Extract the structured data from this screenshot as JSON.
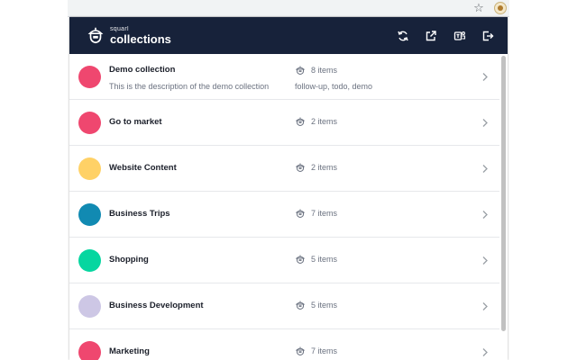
{
  "browser": {
    "star_icon": "star-icon",
    "extension_icon": "acorn-extension-icon"
  },
  "header": {
    "logo_small": "squarl",
    "logo_big": "collections",
    "buttons": [
      {
        "name": "sync-icon"
      },
      {
        "name": "open-external-icon"
      },
      {
        "name": "teams-icon"
      },
      {
        "name": "logout-icon"
      }
    ],
    "background": "#17223a"
  },
  "collections": [
    {
      "name": "Demo collection",
      "description": "This is the description of the demo collection",
      "count": "8 items",
      "tags": "follow-up, todo, demo",
      "color": "#ef476f"
    },
    {
      "name": "Go to market",
      "description": "",
      "count": "2 items",
      "tags": "",
      "color": "#ef476f"
    },
    {
      "name": "Website Content",
      "description": "",
      "count": "2 items",
      "tags": "",
      "color": "#ffd166"
    },
    {
      "name": "Business Trips",
      "description": "",
      "count": "7 items",
      "tags": "",
      "color": "#118ab2"
    },
    {
      "name": "Shopping",
      "description": "",
      "count": "5 items",
      "tags": "",
      "color": "#06d6a0"
    },
    {
      "name": "Business Development",
      "description": "",
      "count": "5 items",
      "tags": "",
      "color": "#cdc7e5"
    },
    {
      "name": "Marketing",
      "description": "",
      "count": "7 items",
      "tags": "",
      "color": "#ef476f"
    }
  ]
}
